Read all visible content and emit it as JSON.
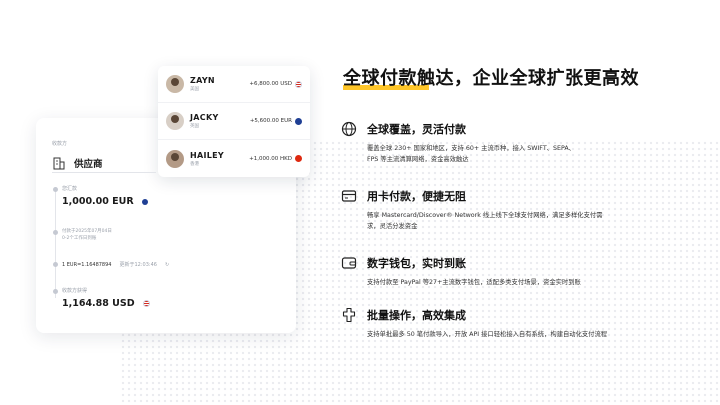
{
  "headline": "全球付款触达，企业全球扩张更高效",
  "colors": {
    "accent": "#ffc629",
    "text": "#111111"
  },
  "recipients": [
    {
      "name": "ZAYN",
      "region": "美国",
      "amount": "+6,800.00 USD",
      "flag": "us-flag-icon"
    },
    {
      "name": "JACKY",
      "region": "英国",
      "amount": "+5,600.00 EUR",
      "flag": "eu-flag-icon"
    },
    {
      "name": "HAILEY",
      "region": "香港",
      "amount": "+1,000.00 HKD",
      "flag": "hk-flag-icon"
    }
  ],
  "payer_card": {
    "payer_label": "收款方",
    "supplier_name": "供应商",
    "send_label": "您汇款",
    "send_amount": "1,000.00 EUR",
    "arrival_note": "付款于2025年07月04日",
    "arrival_sub": "0-2个工作日到账",
    "rate_text": "1 EUR=1.16487894",
    "rate_update": "更新于12:03:46",
    "receive_label": "收款方获得",
    "receive_amount": "1,164.88 USD"
  },
  "features": [
    {
      "icon": "globe-icon",
      "title": "全球覆盖，灵活付款",
      "desc_line1": "覆盖全球 230+ 国家和地区，支持 60+ 主流币种，接入 SWIFT、SEPA、",
      "desc_line2": "FPS 等主流清算网络，资金高效触达"
    },
    {
      "icon": "card-icon",
      "title": "用卡付款，便捷无阻",
      "desc_line1": "畅享 Mastercard/Discover® Network 线上线下全球支付网络，满足多样化支付需",
      "desc_line2": "求，灵活分发资金"
    },
    {
      "icon": "wallet-icon",
      "title": "数字钱包，实时到账",
      "desc_line1": "支持付款至 PayPal 等27+主流数字钱包，适配多类支付场景，资金实时到账",
      "desc_line2": ""
    },
    {
      "icon": "integration-icon",
      "title": "批量操作，高效集成",
      "desc_line1": "支持单批最多 50 笔付款导入，开放 API 接口轻松接入自有系统，构建自动化支付流程",
      "desc_line2": ""
    }
  ]
}
